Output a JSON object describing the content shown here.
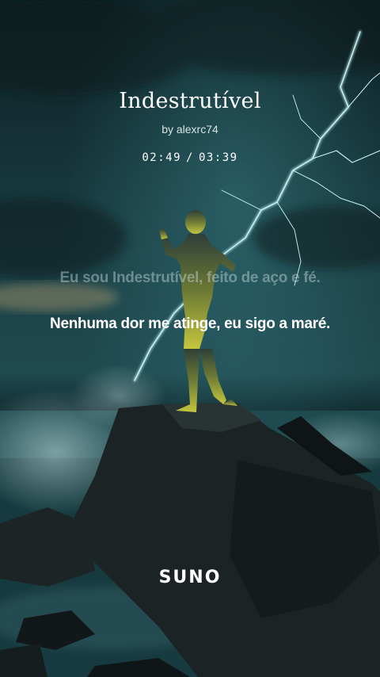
{
  "song": {
    "title": "Indestrutível",
    "artist": "by alexrc74"
  },
  "playback": {
    "current_time": "02:49",
    "separator": "/",
    "total_time": "03:39",
    "progress_fraction": 0.772
  },
  "lyrics": {
    "previous_line": "Eu sou Indestrutível, feito de aço e fé.",
    "current_line": "Nenhuma dor me atinge, eu sigo a maré."
  },
  "brand": {
    "logo_text": "SUNO"
  },
  "colors": {
    "sky": "#16393e",
    "sea": "#1d4a4f",
    "rock": "#1e2627",
    "lightning": "#bff4f6",
    "figure": "#c2c63a",
    "text": "#ffffff"
  }
}
